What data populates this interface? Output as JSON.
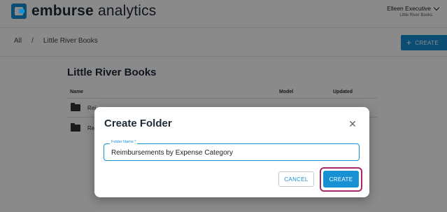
{
  "header": {
    "logo_bold": "emburse",
    "logo_light": " analytics",
    "user_name": "Elleen Executive",
    "user_org": "Little River Books"
  },
  "breadcrumb": {
    "items": [
      "All",
      "/",
      "Little River Books"
    ]
  },
  "toolbar": {
    "create_label": "CREATE"
  },
  "main": {
    "title": "Little River Books",
    "columns": [
      "Name",
      "Model",
      "Updated"
    ],
    "rows": [
      {
        "label": "Rei"
      },
      {
        "label": "Re"
      }
    ]
  },
  "dialog": {
    "title": "Create Folder",
    "field_label": "Folder Name *",
    "field_value": "Reimbursements by Expense Category",
    "cancel_label": "CANCEL",
    "create_label": "CREATE"
  },
  "icons": {
    "close": "close-icon",
    "folder": "folder-icon",
    "chevron": "chevron-down-icon",
    "plus": "plus-icon"
  },
  "colors": {
    "accent": "#1790d4",
    "highlight": "#a52a67"
  }
}
